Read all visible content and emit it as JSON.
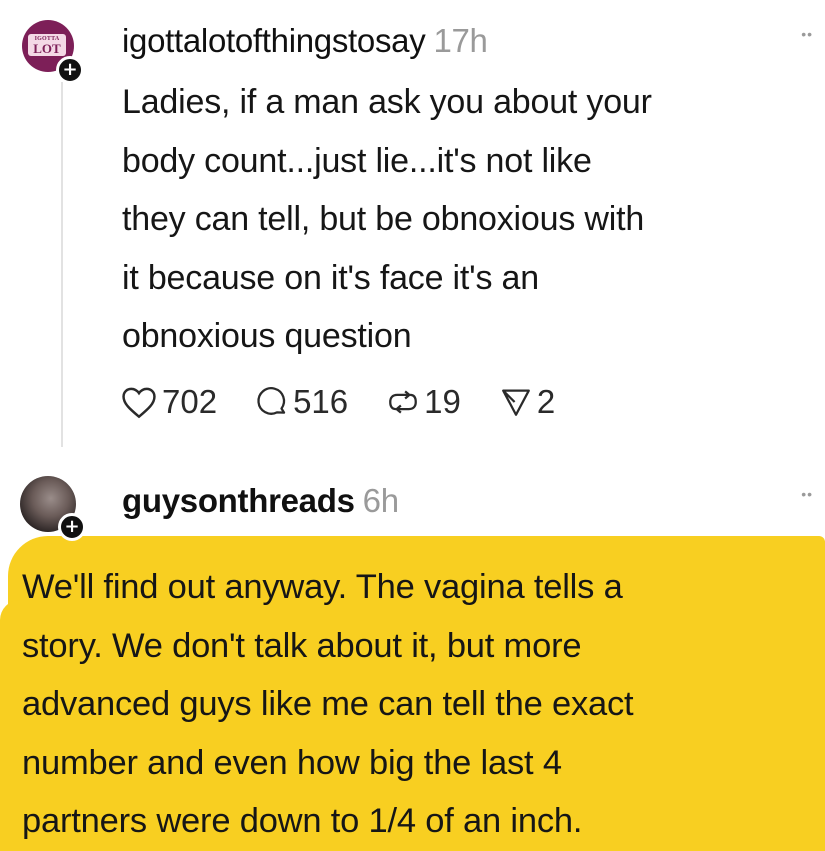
{
  "colors": {
    "highlight": "#f8cf21",
    "avatar1": "#7d1f58",
    "timestamp": "#9a9a9a"
  },
  "posts": [
    {
      "username": "igottalotofthingstosay",
      "time": "17h",
      "avatar_text_small": "IGOTTA",
      "avatar_text_big": "LOT",
      "body": "Ladies, if a man ask you about your\nbody count...just lie...it's not like\nthey can tell, but be obnoxious with\nit because on it's face it's an\nobnoxious question",
      "likes": "702",
      "comments": "516",
      "reposts": "19",
      "shares": "2",
      "icons": [
        "heart-icon",
        "comment-icon",
        "repost-icon",
        "share-icon",
        "more-icon",
        "plus-icon"
      ]
    },
    {
      "username": "guysonthreads",
      "time": "6h",
      "body": "We'll find out anyway. The vagina tells a\nstory. We don't talk about it, but more\nadvanced guys like me can tell the exact\nnumber and even how big the last 4\npartners were down to 1/4 of an inch.",
      "icons": [
        "more-icon",
        "plus-icon"
      ]
    }
  ]
}
